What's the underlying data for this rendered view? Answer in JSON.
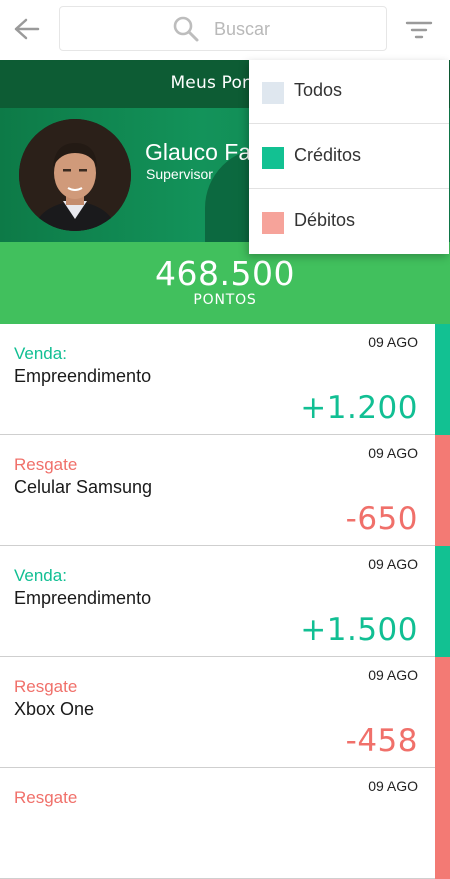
{
  "header": {
    "back_icon": "arrow-left-icon",
    "search_icon": "search-icon",
    "search_placeholder": "Buscar",
    "filter_icon": "filter-icon"
  },
  "page_title": "Meus Pontos",
  "profile": {
    "name": "Glauco Fa",
    "role": "Supervisor"
  },
  "points": {
    "value": "468.500",
    "label": "PONTOS"
  },
  "transactions": [
    {
      "type": "Venda:",
      "description": "Empreendimento",
      "date": "09 AGO",
      "amount": "+1.200",
      "kind": "credit"
    },
    {
      "type": "Resgate",
      "description": "Celular Samsung",
      "date": "09 AGO",
      "amount": "-650",
      "kind": "debit"
    },
    {
      "type": "Venda:",
      "description": "Empreendimento",
      "date": "09 AGO",
      "amount": "+1.500",
      "kind": "credit"
    },
    {
      "type": "Resgate",
      "description": "Xbox One",
      "date": "09 AGO",
      "amount": "-458",
      "kind": "debit"
    },
    {
      "type": "Resgate",
      "description": "",
      "date": "09 AGO",
      "amount": "",
      "kind": "debit"
    }
  ],
  "filter_menu": [
    {
      "label": "Todos",
      "color": "#dfe7ef"
    },
    {
      "label": "Créditos",
      "color": "#12c192"
    },
    {
      "label": "Débitos",
      "color": "#f6a39a"
    }
  ],
  "colors": {
    "title_bar": "#0d5c34",
    "points_bar": "#41c05d",
    "credit": "#11bf93",
    "debit": "#f0706a"
  }
}
